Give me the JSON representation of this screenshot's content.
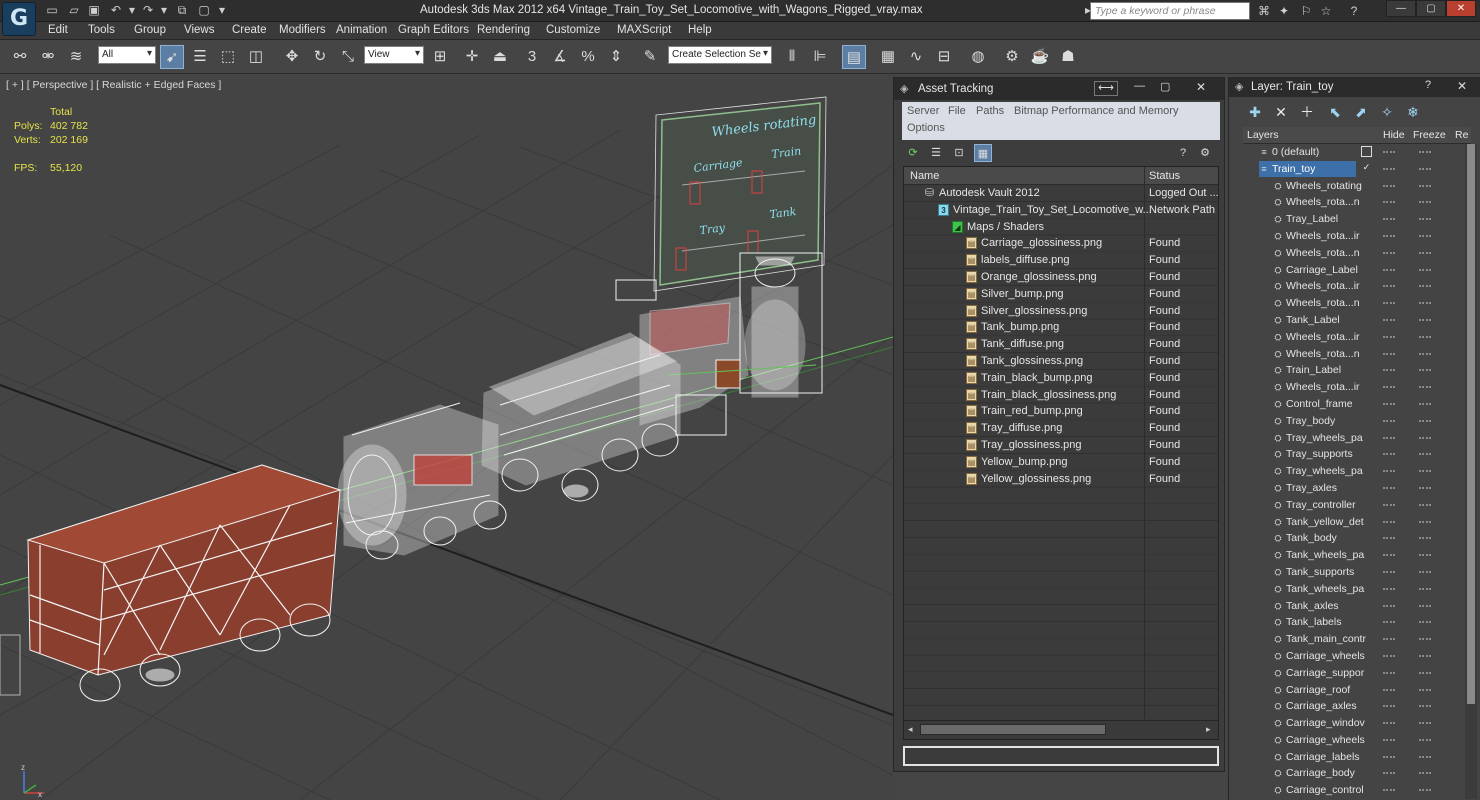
{
  "app": {
    "window_title": "Autodesk 3ds Max  2012 x64     Vintage_Train_Toy_Set_Locomotive_with_Wagons_Rigged_vray.max",
    "search_placeholder": "Type a keyword or phrase"
  },
  "menu": [
    "Edit",
    "Tools",
    "Group",
    "Views",
    "Create",
    "Modifiers",
    "Animation",
    "Graph Editors",
    "Rendering",
    "Customize",
    "MAXScript",
    "Help"
  ],
  "toolbar": {
    "filter_dropdown": "All",
    "coord_dropdown": "View",
    "selection_set": "Create Selection Se",
    "snap_3": "3",
    "snap_angle": "%"
  },
  "viewport": {
    "label": "[ + ] [ Perspective ] [ Realistic + Edged Faces ]",
    "stats": {
      "total_label": "Total",
      "polys_label": "Polys:",
      "polys_value": "402 782",
      "verts_label": "Verts:",
      "verts_value": "202 169",
      "fps_label": "FPS:",
      "fps_value": "55,120"
    },
    "board": {
      "title": "Wheels rotating",
      "carriage": "Carriage",
      "train": "Train",
      "tray": "Tray",
      "tank": "Tank"
    },
    "axis_x": "x",
    "axis_z": "z"
  },
  "asset_tracking": {
    "title": "Asset Tracking",
    "menu": [
      "Server",
      "File",
      "Paths",
      "Bitmap Performance and Memory",
      "Options"
    ],
    "columns": {
      "name": "Name",
      "status": "Status"
    },
    "rows": [
      {
        "name": "Autodesk Vault 2012",
        "status": "Logged Out ...",
        "icon": "vault",
        "indent": 1
      },
      {
        "name": "Vintage_Train_Toy_Set_Locomotive_w...",
        "status": "Network Path",
        "icon": "max",
        "indent": 2
      },
      {
        "name": "Maps / Shaders",
        "status": "",
        "icon": "folder",
        "indent": 3
      },
      {
        "name": "Carriage_glossiness.png",
        "status": "Found",
        "icon": "file",
        "indent": 4
      },
      {
        "name": "labels_diffuse.png",
        "status": "Found",
        "icon": "file",
        "indent": 4
      },
      {
        "name": "Orange_glossiness.png",
        "status": "Found",
        "icon": "file",
        "indent": 4
      },
      {
        "name": "Silver_bump.png",
        "status": "Found",
        "icon": "file",
        "indent": 4
      },
      {
        "name": "Silver_glossiness.png",
        "status": "Found",
        "icon": "file",
        "indent": 4
      },
      {
        "name": "Tank_bump.png",
        "status": "Found",
        "icon": "file",
        "indent": 4
      },
      {
        "name": "Tank_diffuse.png",
        "status": "Found",
        "icon": "file",
        "indent": 4
      },
      {
        "name": "Tank_glossiness.png",
        "status": "Found",
        "icon": "file",
        "indent": 4
      },
      {
        "name": "Train_black_bump.png",
        "status": "Found",
        "icon": "file",
        "indent": 4
      },
      {
        "name": "Train_black_glossiness.png",
        "status": "Found",
        "icon": "file",
        "indent": 4
      },
      {
        "name": "Train_red_bump.png",
        "status": "Found",
        "icon": "file",
        "indent": 4
      },
      {
        "name": "Tray_diffuse.png",
        "status": "Found",
        "icon": "file",
        "indent": 4
      },
      {
        "name": "Tray_glossiness.png",
        "status": "Found",
        "icon": "file",
        "indent": 4
      },
      {
        "name": "Yellow_bump.png",
        "status": "Found",
        "icon": "file",
        "indent": 4
      },
      {
        "name": "Yellow_glossiness.png",
        "status": "Found",
        "icon": "file",
        "indent": 4
      }
    ]
  },
  "layers": {
    "title": "Layer: Train_toy",
    "columns": {
      "layers": "Layers",
      "hide": "Hide",
      "freeze": "Freeze",
      "render": "Re"
    },
    "rows": [
      {
        "name": "0 (default)",
        "level": 0,
        "selected": false,
        "layer": true
      },
      {
        "name": "Train_toy",
        "level": 0,
        "selected": true,
        "layer": true
      },
      {
        "name": "Wheels_rotating",
        "level": 1
      },
      {
        "name": "Wheels_rota...n",
        "level": 1
      },
      {
        "name": "Tray_Label",
        "level": 1
      },
      {
        "name": "Wheels_rota...ir",
        "level": 1
      },
      {
        "name": "Wheels_rota...n",
        "level": 1
      },
      {
        "name": "Carriage_Label",
        "level": 1
      },
      {
        "name": "Wheels_rota...ir",
        "level": 1
      },
      {
        "name": "Wheels_rota...n",
        "level": 1
      },
      {
        "name": "Tank_Label",
        "level": 1
      },
      {
        "name": "Wheels_rota...ir",
        "level": 1
      },
      {
        "name": "Wheels_rota...n",
        "level": 1
      },
      {
        "name": "Train_Label",
        "level": 1
      },
      {
        "name": "Wheels_rota...ir",
        "level": 1
      },
      {
        "name": "Control_frame",
        "level": 1
      },
      {
        "name": "Tray_body",
        "level": 1
      },
      {
        "name": "Tray_wheels_pa",
        "level": 1
      },
      {
        "name": "Tray_supports",
        "level": 1
      },
      {
        "name": "Tray_wheels_pa",
        "level": 1
      },
      {
        "name": "Tray_axles",
        "level": 1
      },
      {
        "name": "Tray_controller",
        "level": 1
      },
      {
        "name": "Tank_yellow_det",
        "level": 1
      },
      {
        "name": "Tank_body",
        "level": 1
      },
      {
        "name": "Tank_wheels_pa",
        "level": 1
      },
      {
        "name": "Tank_supports",
        "level": 1
      },
      {
        "name": "Tank_wheels_pa",
        "level": 1
      },
      {
        "name": "Tank_axles",
        "level": 1
      },
      {
        "name": "Tank_labels",
        "level": 1
      },
      {
        "name": "Tank_main_contr",
        "level": 1
      },
      {
        "name": "Carriage_wheels",
        "level": 1
      },
      {
        "name": "Carriage_suppor",
        "level": 1
      },
      {
        "name": "Carriage_roof",
        "level": 1
      },
      {
        "name": "Carriage_axles",
        "level": 1
      },
      {
        "name": "Carriage_windov",
        "level": 1
      },
      {
        "name": "Carriage_wheels",
        "level": 1
      },
      {
        "name": "Carriage_labels",
        "level": 1
      },
      {
        "name": "Carriage_body",
        "level": 1
      },
      {
        "name": "Carriage_control",
        "level": 1
      }
    ]
  }
}
